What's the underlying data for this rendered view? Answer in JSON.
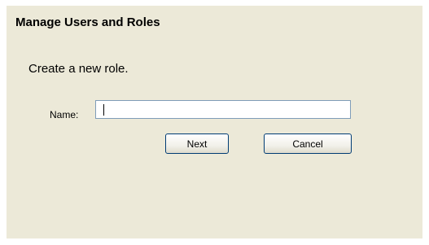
{
  "dialog": {
    "title": "Manage Users and Roles",
    "subtitle": "Create a new role.",
    "name_label": "Name:",
    "name_value": "",
    "next_label": "Next",
    "cancel_label": "Cancel"
  },
  "colors": {
    "dialog_background": "#ece9d8",
    "input_border": "#7f9db9",
    "button_border": "#003c74"
  }
}
